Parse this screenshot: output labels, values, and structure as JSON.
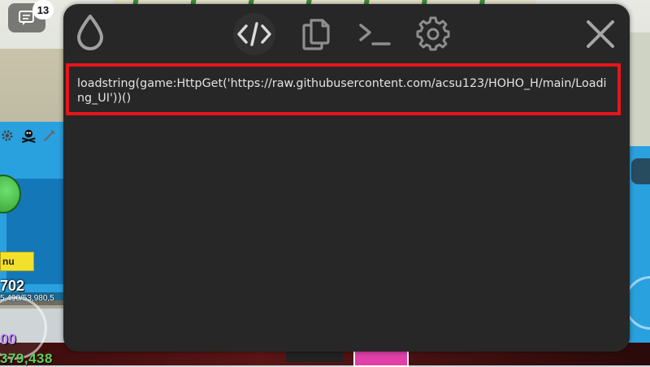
{
  "chat": {
    "badge_count": "13"
  },
  "hud": {
    "name_tag": "nu",
    "level": "702",
    "xp": "5,490/53,980,5",
    "purple_value": "00",
    "money": "379,438"
  },
  "toolbar": {
    "items": [
      {
        "name": "logo",
        "icon": "droplet-icon"
      },
      {
        "name": "editor",
        "icon": "code-icon",
        "active": true
      },
      {
        "name": "copy",
        "icon": "copy-icon"
      },
      {
        "name": "console",
        "icon": "terminal-icon"
      },
      {
        "name": "settings",
        "icon": "gear-icon"
      },
      {
        "name": "close",
        "icon": "close-icon"
      }
    ]
  },
  "editor": {
    "script_text": "loadstring(game:HttpGet('https://raw.githubusercontent.com/acsu123/HOHO_H/main/Loading_UI'))()",
    "highlight_color": "#e8151b"
  },
  "colors": {
    "panel_bg": "#272727",
    "icon": "#9a9a9a",
    "active_icon": "#d8d8d8",
    "text": "#e4e4e4"
  }
}
